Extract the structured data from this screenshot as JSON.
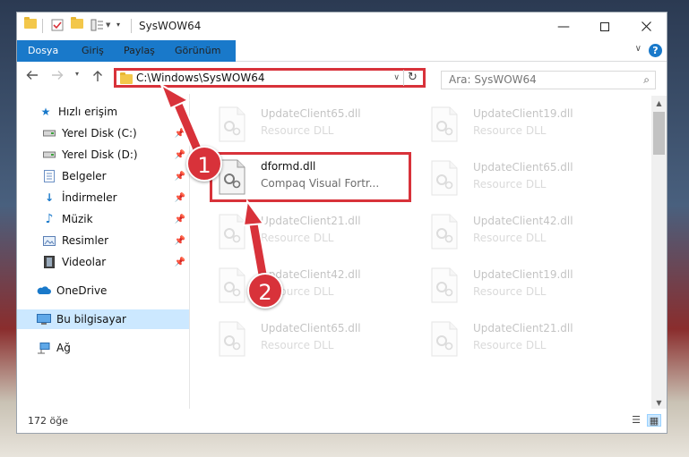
{
  "window": {
    "title": "SysWOW64"
  },
  "ribbon": {
    "tabs": [
      {
        "label": "Dosya"
      },
      {
        "label": "Giriş"
      },
      {
        "label": "Paylaş"
      },
      {
        "label": "Görünüm"
      }
    ],
    "help_label": "?"
  },
  "nav": {
    "address": "C:\\Windows\\SysWOW64",
    "search_placeholder": "Ara: SysWOW64"
  },
  "sidebar": {
    "items": [
      {
        "label": "Hızlı erişim",
        "icon": "star-icon",
        "pinned": false
      },
      {
        "label": "Yerel Disk (C:)",
        "icon": "drive-icon",
        "pinned": true
      },
      {
        "label": "Yerel Disk (D:)",
        "icon": "drive-icon",
        "pinned": true
      },
      {
        "label": "Belgeler",
        "icon": "documents-icon",
        "pinned": true
      },
      {
        "label": "İndirmeler",
        "icon": "download-icon",
        "pinned": true
      },
      {
        "label": "Müzik",
        "icon": "music-icon",
        "pinned": true
      },
      {
        "label": "Resimler",
        "icon": "pictures-icon",
        "pinned": true
      },
      {
        "label": "Videolar",
        "icon": "videos-icon",
        "pinned": true
      },
      {
        "label": "OneDrive",
        "icon": "cloud-icon",
        "pinned": false
      },
      {
        "label": "Bu bilgisayar",
        "icon": "computer-icon",
        "pinned": false,
        "selected": true
      },
      {
        "label": "Ağ",
        "icon": "network-icon",
        "pinned": false
      }
    ]
  },
  "files": {
    "col1": [
      {
        "name": "UpdateClient65.dll",
        "desc": "Resource DLL"
      },
      {
        "name": "dformd.dll",
        "desc": "Compaq Visual Fortr...",
        "highlighted": true
      },
      {
        "name": "UpdateClient21.dll",
        "desc": "Resource DLL"
      },
      {
        "name": "UpdateClient42.dll",
        "desc": "Resource DLL"
      },
      {
        "name": "UpdateClient65.dll",
        "desc": "Resource DLL"
      }
    ],
    "col2": [
      {
        "name": "UpdateClient19.dll",
        "desc": "Resource DLL"
      },
      {
        "name": "UpdateClient65.dll",
        "desc": "Resource DLL"
      },
      {
        "name": "UpdateClient42.dll",
        "desc": "Resource DLL"
      },
      {
        "name": "UpdateClient19.dll",
        "desc": "Resource DLL"
      },
      {
        "name": "UpdateClient21.dll",
        "desc": "Resource DLL"
      }
    ]
  },
  "status": {
    "count": "172 öğe"
  },
  "annotations": {
    "step1": "1",
    "step2": "2",
    "color": "#d8323a"
  },
  "colors": {
    "accent": "#1979ca",
    "selection": "#cce8ff"
  }
}
